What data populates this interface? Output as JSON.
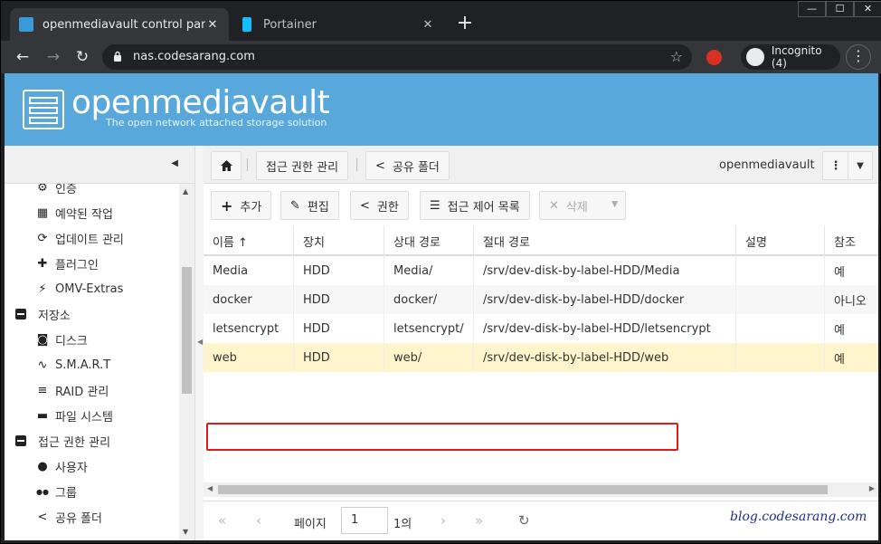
{
  "browser": {
    "tabs": [
      {
        "title": "openmediavault control panel - c",
        "active": true
      },
      {
        "title": "Portainer",
        "active": false
      }
    ],
    "url": "nas.codesarang.com",
    "profile_label": "Incognito (4)",
    "window_buttons": [
      "—",
      "☐",
      "✕"
    ]
  },
  "omv": {
    "logo_text": "openmediavault",
    "logo_sub": "The open network attached storage solution"
  },
  "nav_tree": [
    {
      "label": "인증",
      "icon": "certificate-icon",
      "indent": 1
    },
    {
      "label": "예약된 작업",
      "icon": "calendar-icon",
      "indent": 1
    },
    {
      "label": "업데이트 관리",
      "icon": "refresh-icon",
      "indent": 1
    },
    {
      "label": "플러그인",
      "icon": "puzzle-icon",
      "indent": 1
    },
    {
      "label": "OMV-Extras",
      "icon": "plug-icon",
      "indent": 1
    },
    {
      "label": "저장소",
      "icon": "collapse-icon",
      "indent": 0
    },
    {
      "label": "디스크",
      "icon": "disk-icon",
      "indent": 1
    },
    {
      "label": "S.M.A.R.T",
      "icon": "pulse-icon",
      "indent": 1
    },
    {
      "label": "RAID 관리",
      "icon": "database-icon",
      "indent": 1
    },
    {
      "label": "파일 시스템",
      "icon": "folder-icon",
      "indent": 1
    },
    {
      "label": "접근 권한 관리",
      "icon": "collapse-icon",
      "indent": 0
    },
    {
      "label": "사용자",
      "icon": "user-icon",
      "indent": 1
    },
    {
      "label": "그룹",
      "icon": "group-icon",
      "indent": 1
    },
    {
      "label": "공유 폴더",
      "icon": "share-icon",
      "indent": 1
    }
  ],
  "breadcrumb": {
    "home_icon": "home-icon",
    "items": [
      "접근 권한 관리",
      "공유 폴더"
    ],
    "brand": "openmediavault"
  },
  "actions": {
    "add": "추가",
    "edit": "편집",
    "privileges": "권한",
    "acl": "접근 제어 목록",
    "delete": "삭제"
  },
  "grid": {
    "columns": [
      "이름 ↑",
      "장치",
      "상대 경로",
      "절대 경로",
      "설명",
      "참조"
    ],
    "rows": [
      [
        "Media",
        "HDD",
        "Media/",
        "/srv/dev-disk-by-label-HDD/Media",
        "",
        "예"
      ],
      [
        "docker",
        "HDD",
        "docker/",
        "/srv/dev-disk-by-label-HDD/docker",
        "",
        "아니오"
      ],
      [
        "letsencrypt",
        "HDD",
        "letsencrypt/",
        "/srv/dev-disk-by-label-HDD/letsencrypt",
        "",
        "예"
      ],
      [
        "web",
        "HDD",
        "web/",
        "/srv/dev-disk-by-label-HDD/web",
        "",
        "예"
      ]
    ],
    "selected_row": 3
  },
  "pager": {
    "page_label": "페이지",
    "page_value": "1",
    "of_label": "1의"
  },
  "watermark": "blog.codesarang.com",
  "colors": {
    "header_bg": "#58a8dc",
    "selected_row": "#fff5cc",
    "highlight": "#e5171d"
  }
}
